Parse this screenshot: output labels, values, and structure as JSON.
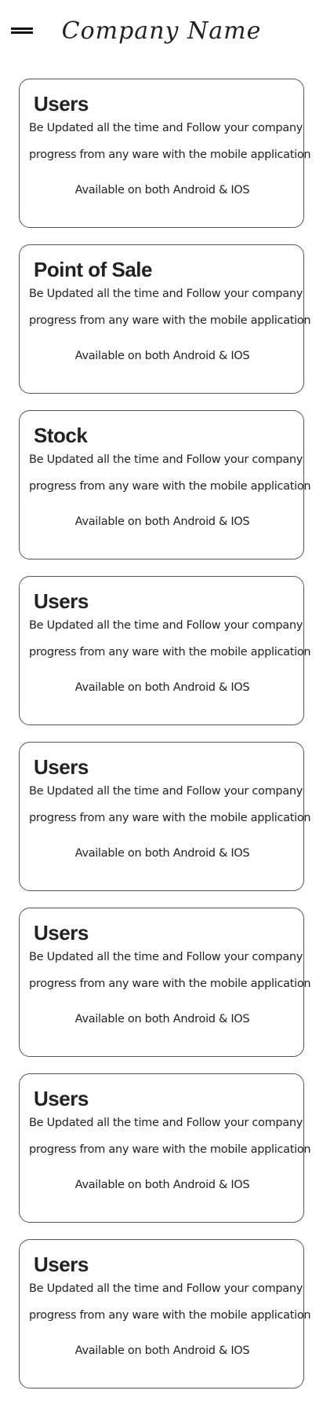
{
  "header": {
    "menu_icon": "hamburger-menu-icon",
    "title": "Company Name"
  },
  "cards": [
    {
      "title": "Users",
      "line1": "Be Updated all the time and Follow your company",
      "line2": "progress from any ware with the mobile application",
      "line3": "Available on both Android & IOS"
    },
    {
      "title": "Point of Sale",
      "line1": "Be Updated all the time and Follow your company",
      "line2": "progress from any ware with the mobile application",
      "line3": "Available on both Android & IOS"
    },
    {
      "title": "Stock",
      "line1": "Be Updated all the time and Follow your company",
      "line2": "progress from any ware with the mobile application",
      "line3": "Available on both Android & IOS"
    },
    {
      "title": "Users",
      "line1": "Be Updated all the time and Follow your company",
      "line2": "progress from any ware with the mobile application",
      "line3": "Available on both Android & IOS"
    },
    {
      "title": "Users",
      "line1": "Be Updated all the time and Follow your company",
      "line2": "progress from any ware with the mobile application",
      "line3": "Available on both Android & IOS"
    },
    {
      "title": "Users",
      "line1": "Be Updated all the time and Follow your company",
      "line2": "progress from any ware with the mobile application",
      "line3": "Available on both Android & IOS"
    },
    {
      "title": "Users",
      "line1": "Be Updated all the time and Follow your company",
      "line2": "progress from any ware with the mobile application",
      "line3": "Available on both Android & IOS"
    },
    {
      "title": "Users",
      "line1": "Be Updated all the time and Follow your company",
      "line2": "progress from any ware with the mobile application",
      "line3": "Available on both Android & IOS"
    }
  ]
}
